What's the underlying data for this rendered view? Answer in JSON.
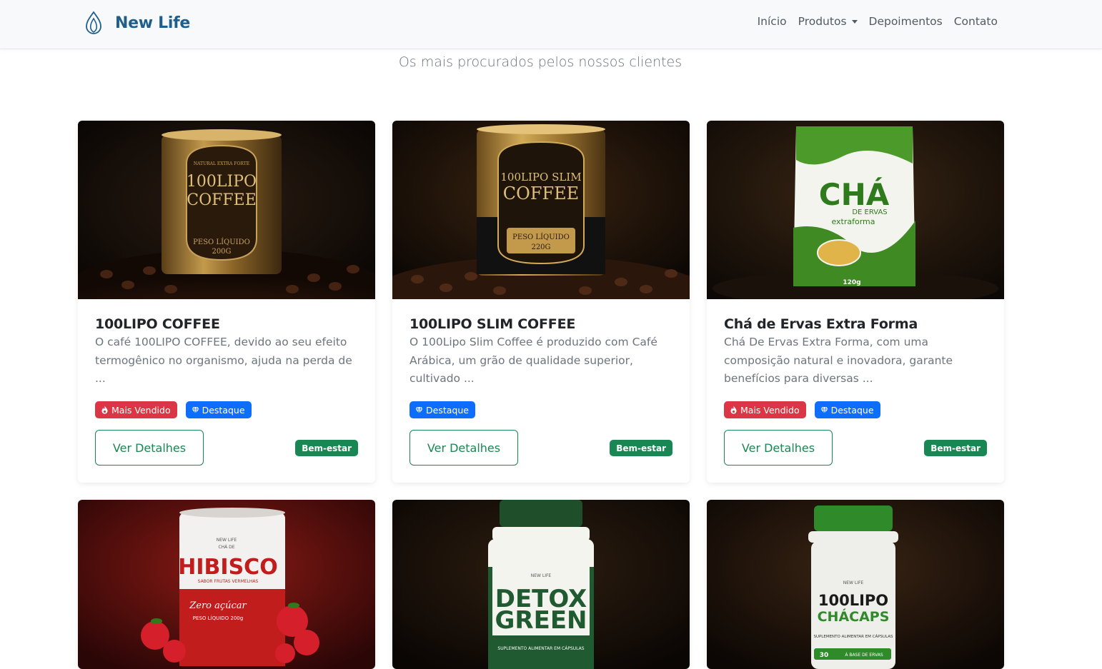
{
  "brand": {
    "name": "New Life",
    "logo_icon": "flame-drop-icon",
    "color": "#1f5f8b"
  },
  "nav": {
    "items": [
      {
        "label": "Início"
      },
      {
        "label": "Produtos"
      },
      {
        "label": "Depoimentos"
      },
      {
        "label": "Contato"
      }
    ]
  },
  "section": {
    "subtitle": "Os mais procurados pelos nossos clientes"
  },
  "products": [
    {
      "title": "100LIPO COFFEE",
      "description": "O café 100LIPO COFFEE, devido ao seu efeito termogênico no organismo, ajuda na perda de ...",
      "badges": {
        "best_seller": "Mais Vendido",
        "featured": "Destaque"
      },
      "button": "Ver Detalhes",
      "category": "Bem-estar",
      "image": {
        "brand_line": "NATURAL EXTRA FORTE",
        "name_top": "100LIPO",
        "name_bottom": "COFFEE",
        "weight": "PESO LÍQUIDO",
        "weight_value": "200G"
      }
    },
    {
      "title": "100LIPO SLIM COFFEE",
      "description": "O 100Lipo Slim Coffee é produzido com Café Arábica, um grão de qualidade superior, cultivado ...",
      "badges": {
        "featured": "Destaque"
      },
      "button": "Ver Detalhes",
      "category": "Bem-estar",
      "image": {
        "name_top": "100LIPO SLIM",
        "name_bottom": "COFFEE",
        "weight": "PESO LÍQUIDO",
        "weight_value": "220G"
      }
    },
    {
      "title": "Chá de Ervas Extra Forma",
      "description": "Chá De Ervas Extra Forma, com uma composição natural e inovadora, garante benefícios para diversas ...",
      "badges": {
        "best_seller": "Mais Vendido",
        "featured": "Destaque"
      },
      "button": "Ver Detalhes",
      "category": "Bem-estar",
      "image": {
        "name_top": "CHÁ",
        "name_mid": "DE ERVAS",
        "name_bottom": "extraforma",
        "weight": "120g"
      }
    },
    {
      "image": {
        "brand": "NEW LIFE",
        "pre": "CHÁ DE",
        "name": "HIBISCO",
        "flavor": "SABOR FRUTAS VERMELHAS",
        "tag": "Zero açúcar",
        "weight": "PESO LÍQUIDO 200g"
      }
    },
    {
      "image": {
        "brand": "NEW LIFE",
        "name_top": "DETOX",
        "name_bottom": "GREEN",
        "label": "SUPLEMENTO ALIMENTAR EM CÁPSULAS"
      }
    },
    {
      "image": {
        "brand": "NEW LIFE",
        "name_top": "100LIPO",
        "name_bottom": "CHÁCAPS",
        "label": "SUPLEMENTO ALIMENTAR EM CÁPSULAS",
        "caps": "30",
        "base": "À BASE DE ERVAS"
      }
    }
  ],
  "colors": {
    "success": "#198754",
    "danger": "#dc3545",
    "primary": "#0d6efd"
  }
}
